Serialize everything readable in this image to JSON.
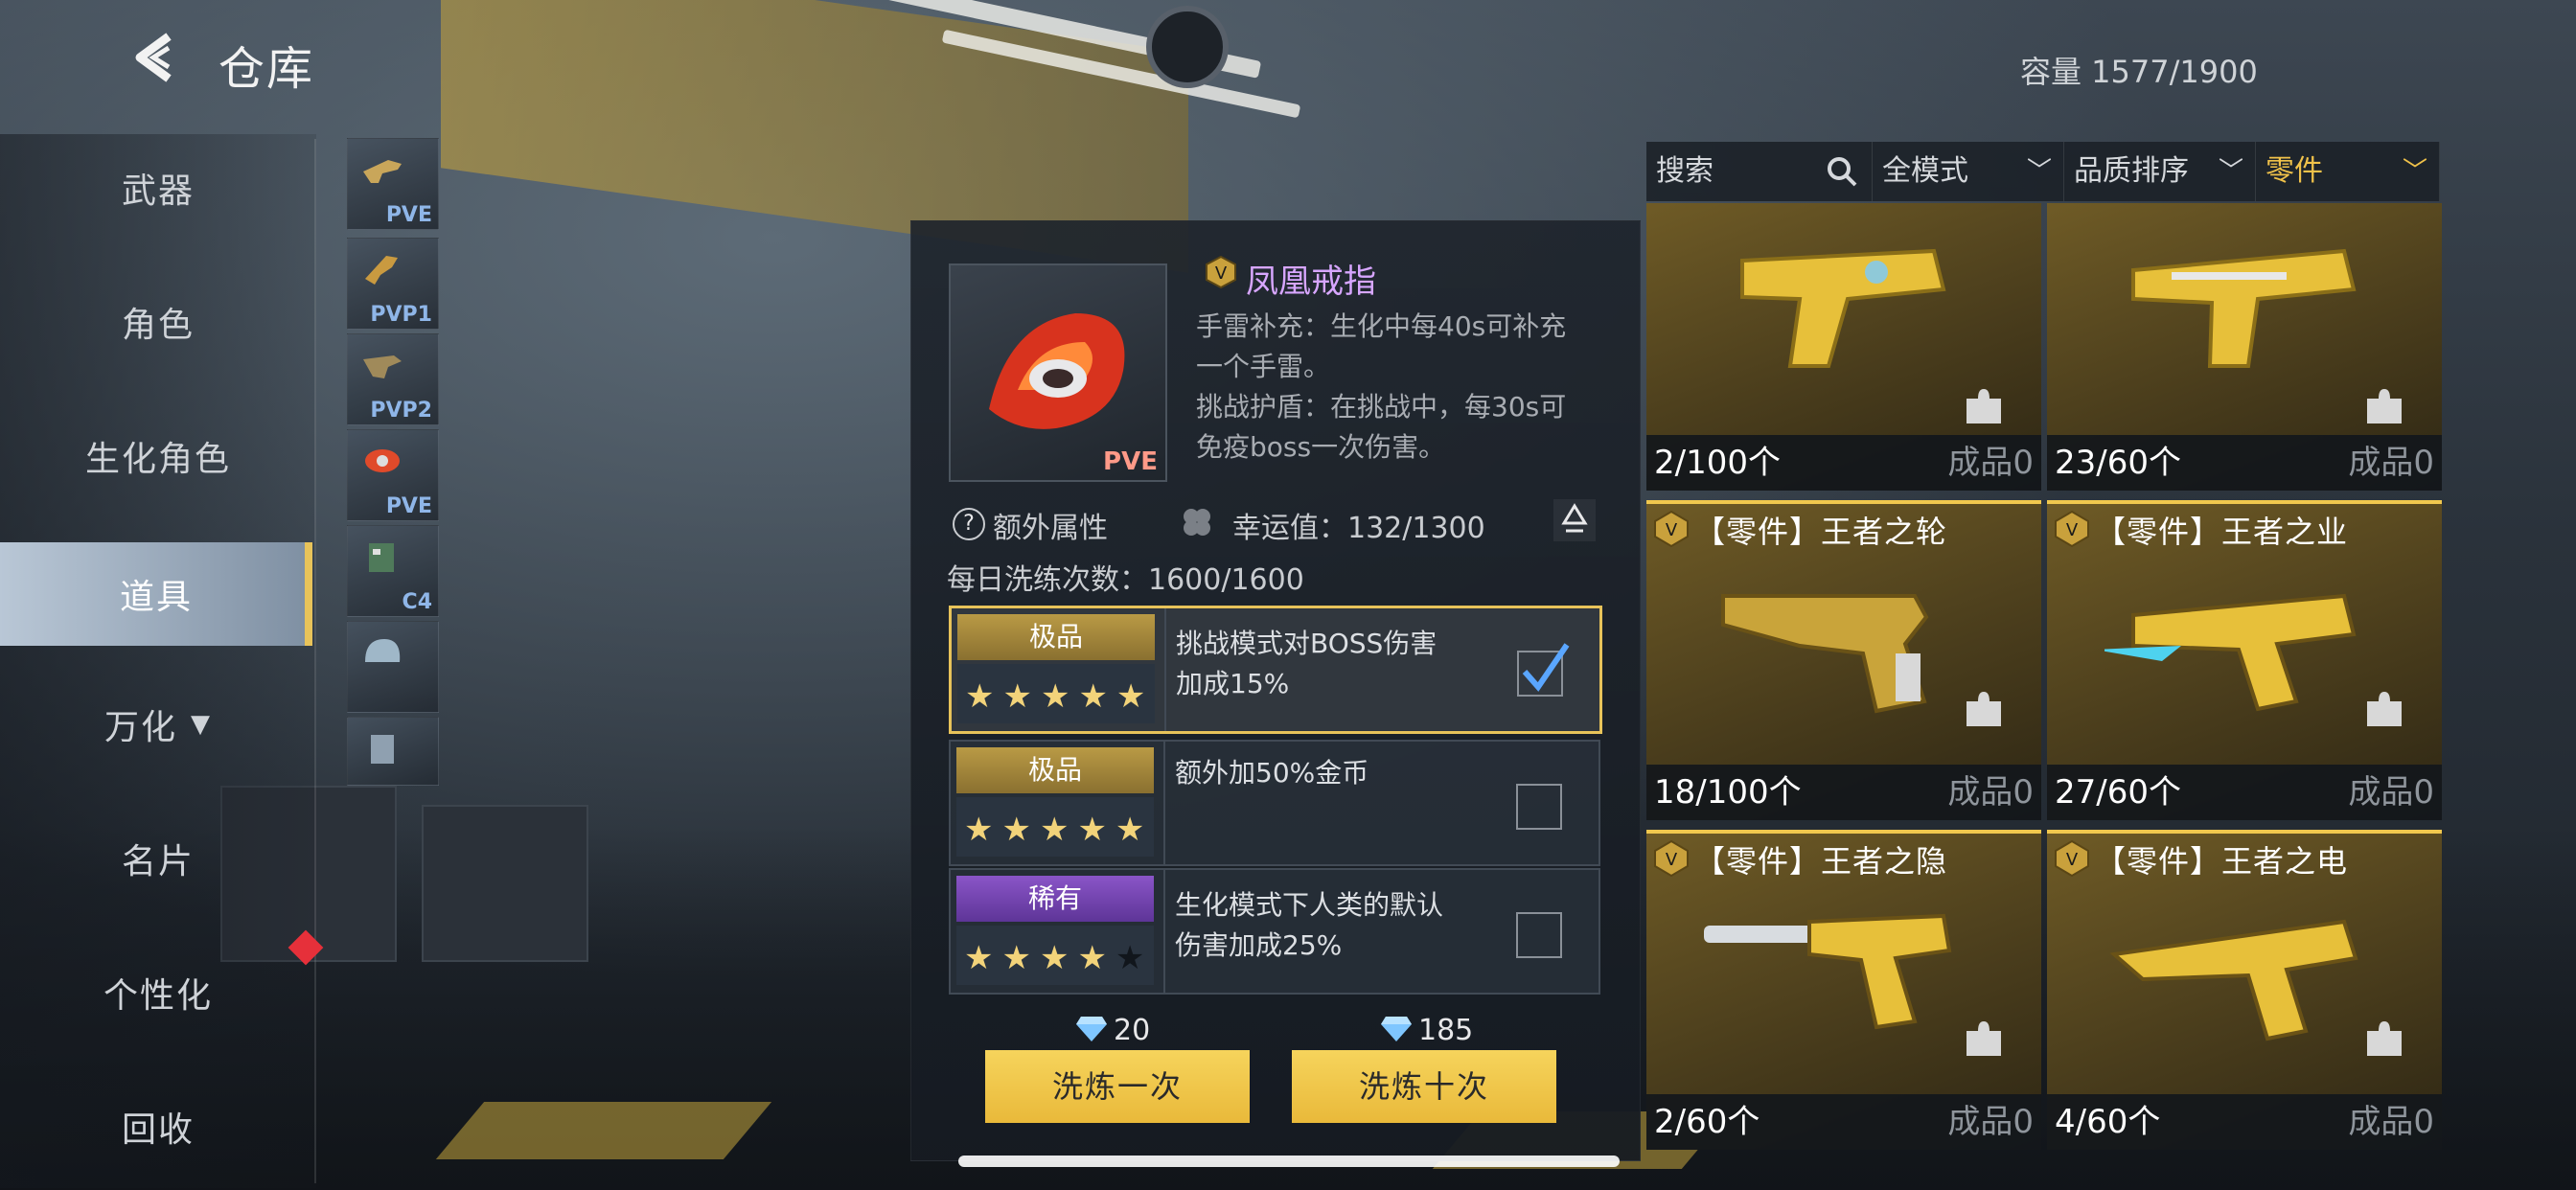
{
  "header": {
    "title": "仓库",
    "capacity": "容量  1577/1900"
  },
  "sidebar": {
    "items": [
      {
        "label": "武器"
      },
      {
        "label": "角色"
      },
      {
        "label": "生化角色"
      },
      {
        "label": "道具"
      },
      {
        "label": "万化"
      },
      {
        "label": "名片"
      },
      {
        "label": "个性化"
      },
      {
        "label": "回收"
      }
    ],
    "active": "道具"
  },
  "subcategories": [
    {
      "tag": "PVE",
      "icon": "weapon-icon"
    },
    {
      "tag": "PVP1",
      "icon": "weapon-icon"
    },
    {
      "tag": "PVP2",
      "icon": "weapon-icon"
    },
    {
      "tag": "PVE",
      "icon": "ring-icon"
    },
    {
      "tag": "C4",
      "icon": "bomb-icon"
    },
    {
      "tag": "",
      "icon": "helmet-icon"
    },
    {
      "tag": "",
      "icon": "helmet-icon"
    }
  ],
  "detail": {
    "item_tag": "PVE",
    "name": "凤凰戒指",
    "desc": [
      "手雷补充：生化中每40s可补充",
      "一个手雷。",
      "挑战护盾：在挑战中，每30s可",
      "免疫boss一次伤害。"
    ],
    "extra_attr": "额外属性",
    "luck": "幸运值：132/1300",
    "daily": "每日洗练次数：1600/1600",
    "options": [
      {
        "grade": "极品",
        "grade_color": "#b99a45",
        "stars": "★★★★★",
        "stars_dim": "",
        "lines": [
          "挑战模式对BOSS伤害",
          "加成15%"
        ],
        "checked": true
      },
      {
        "grade": "极品",
        "grade_color": "#b99a45",
        "stars": "★★★★★",
        "stars_dim": "",
        "lines": [
          "额外加50%金币",
          ""
        ],
        "checked": false
      },
      {
        "grade": "稀有",
        "grade_color": "#8a55c8",
        "stars": "★★★★",
        "stars_dim": "★",
        "lines": [
          "生化模式下人类的默认",
          "伤害加成25%"
        ],
        "checked": false
      }
    ],
    "cost_once": "20",
    "cost_ten": "185",
    "btn_once": "洗炼一次",
    "btn_ten": "洗炼十次"
  },
  "filters": {
    "search": "搜索",
    "mode": "全模式",
    "sort": "品质排序",
    "type": "零件"
  },
  "cards": [
    {
      "name": "",
      "count": "2/100个",
      "made": "成品0",
      "gun_color": "#e7c03a"
    },
    {
      "name": "",
      "count": "23/60个",
      "made": "成品0",
      "gun_color": "#e7c03a"
    },
    {
      "name": "【零件】王者之轮",
      "count": "18/100个",
      "made": "成品0",
      "gun_color": "#c9a43a"
    },
    {
      "name": "【零件】王者之业",
      "count": "27/60个",
      "made": "成品0",
      "gun_color": "#e7c03a"
    },
    {
      "name": "【零件】王者之隐",
      "count": "2/60个",
      "made": "成品0",
      "gun_color": "#e7c03a"
    },
    {
      "name": "【零件】王者之电",
      "count": "4/60个",
      "made": "成品0",
      "gun_color": "#e7c03a"
    }
  ]
}
